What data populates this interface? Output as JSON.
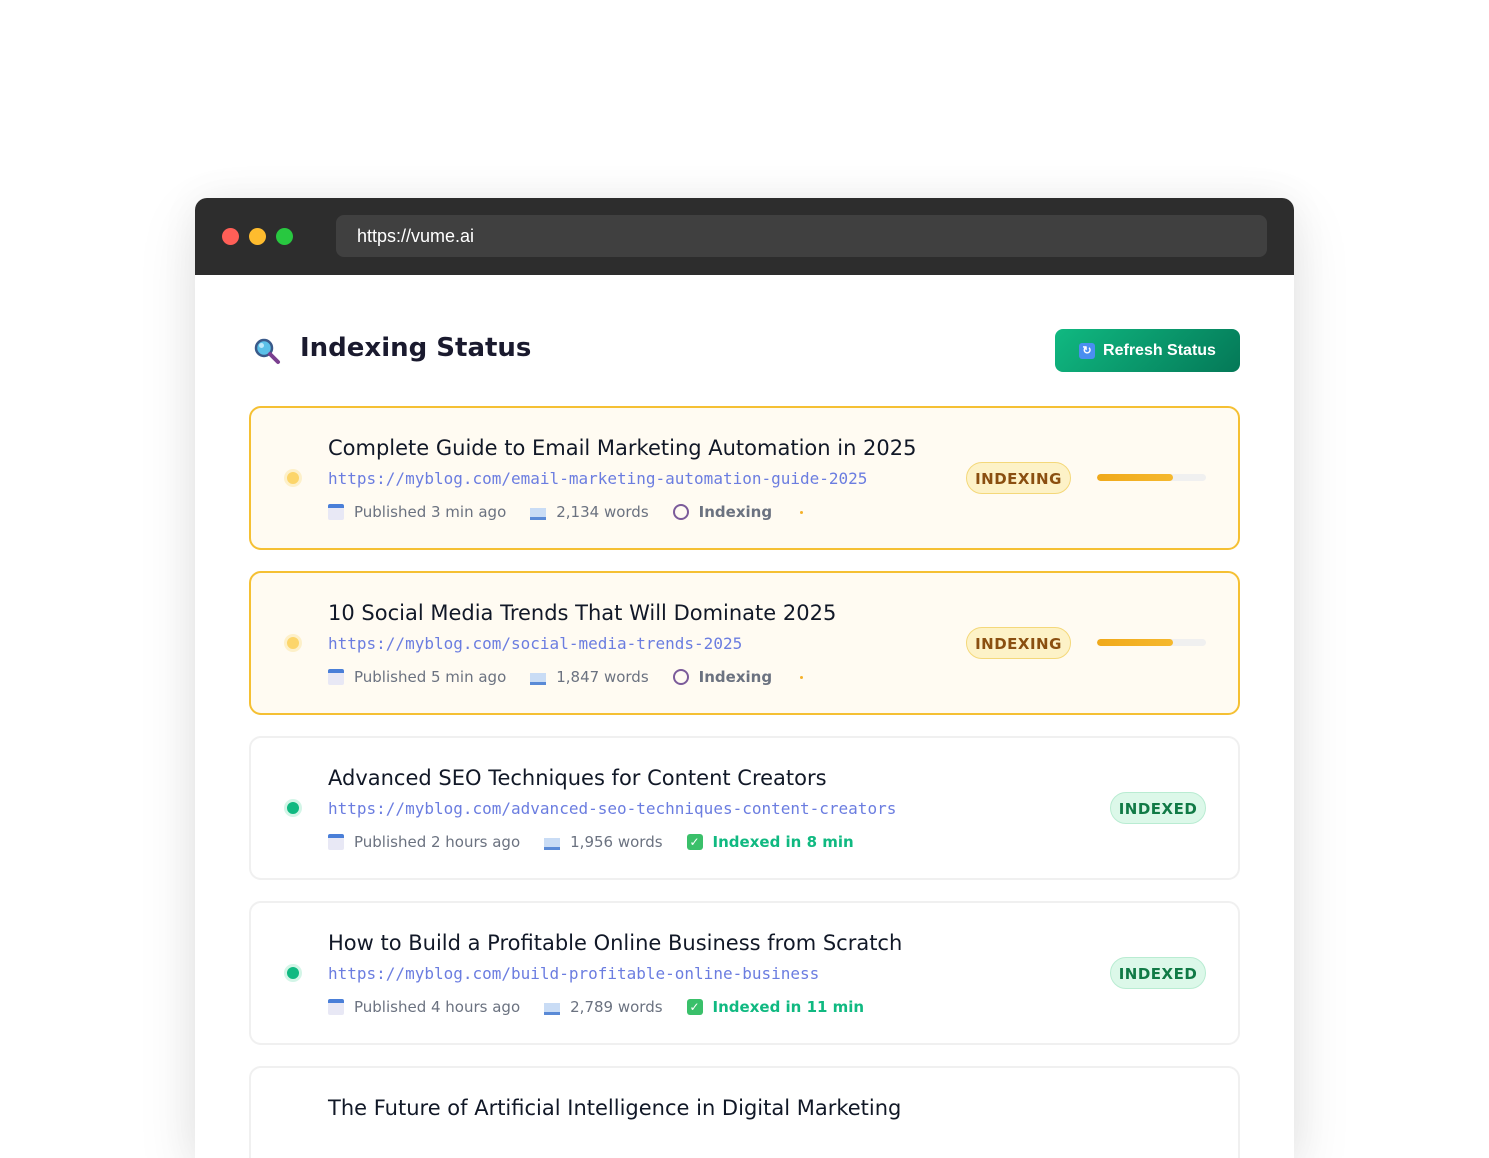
{
  "browser": {
    "url": "https://vume.ai"
  },
  "header": {
    "title": "Indexing Status",
    "refresh_label": "Refresh Status"
  },
  "colors": {
    "accent": "#10b981",
    "indexing": "#f5c033",
    "indexed": "#10b981",
    "url": "#6b7de0"
  },
  "posts": [
    {
      "status": "indexing",
      "title": "Complete Guide to Email Marketing Automation in 2025",
      "url": "https://myblog.com/email-marketing-automation-guide-2025",
      "published": "Published 3 min ago",
      "words": "2,134 words",
      "state_label": "Indexing",
      "badge": "INDEXING",
      "progress": 0.7
    },
    {
      "status": "indexing",
      "title": "10 Social Media Trends That Will Dominate 2025",
      "url": "https://myblog.com/social-media-trends-2025",
      "published": "Published 5 min ago",
      "words": "1,847 words",
      "state_label": "Indexing",
      "badge": "INDEXING",
      "progress": 0.7
    },
    {
      "status": "indexed",
      "title": "Advanced SEO Techniques for Content Creators",
      "url": "https://myblog.com/advanced-seo-techniques-content-creators",
      "published": "Published 2 hours ago",
      "words": "1,956 words",
      "state_label": "Indexed in 8 min",
      "badge": "INDEXED"
    },
    {
      "status": "indexed",
      "title": "How to Build a Profitable Online Business from Scratch",
      "url": "https://myblog.com/build-profitable-online-business",
      "published": "Published 4 hours ago",
      "words": "2,789 words",
      "state_label": "Indexed in 11 min",
      "badge": "INDEXED"
    },
    {
      "status": "",
      "title": "The Future of Artificial Intelligence in Digital Marketing"
    }
  ]
}
